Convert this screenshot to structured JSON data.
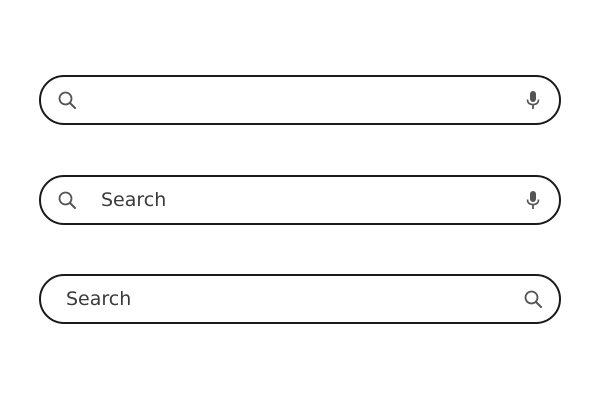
{
  "search_bars": [
    {
      "left_icon": "search-icon",
      "value": "",
      "placeholder": "",
      "right_icon": "microphone-icon"
    },
    {
      "left_icon": "search-icon",
      "value": "",
      "placeholder": "Search",
      "right_icon": "microphone-icon"
    },
    {
      "value": "",
      "placeholder": "Search",
      "right_icon": "search-icon"
    }
  ],
  "colors": {
    "border": "#1a1a1a",
    "text": "#3a3a3a",
    "icon": "#555555",
    "background": "#ffffff"
  }
}
